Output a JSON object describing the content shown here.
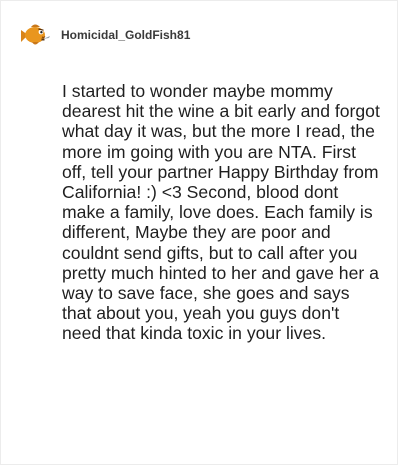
{
  "post": {
    "author": {
      "username": "Homicidal_GoldFish81",
      "avatar_icon": "goldfish-avatar-icon"
    },
    "text": "I started to wonder maybe mommy dearest hit the wine a bit early and forgot what day it was, but the more I read, the more im going with you are NTA. First off, tell your partner Happy Birthday from California! :) <3 Second, blood dont make a family, love does. Each family is different, Maybe they are poor and couldnt send gifts, but to call after you pretty much hinted to her and gave her a way to save face, she goes and says that about you, yeah you guys don't need that kinda toxic in your lives."
  },
  "colors": {
    "avatar_fish": "#e9961e",
    "avatar_fish_dark": "#b86a0f",
    "text": "#1f1f1f",
    "username": "#3a3a3a"
  }
}
